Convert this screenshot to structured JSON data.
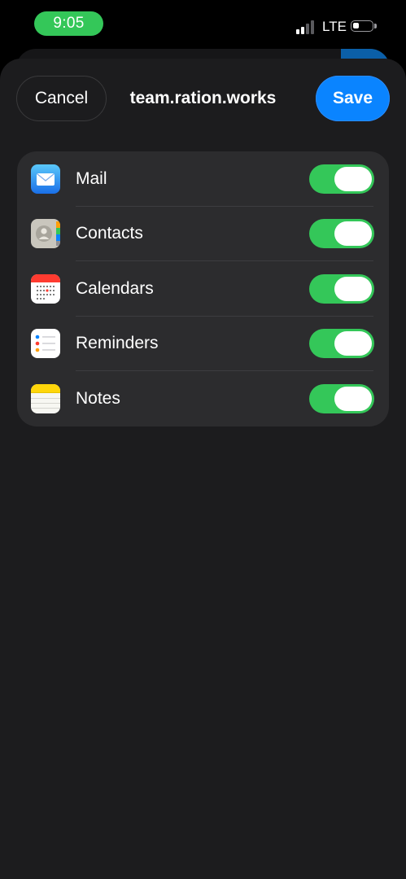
{
  "status_bar": {
    "time": "9:05",
    "network": "LTE",
    "signal_bars_filled": 2,
    "signal_bars_total": 4,
    "battery_level": 0.35
  },
  "colors": {
    "accent_blue": "#0a84ff",
    "toggle_on": "#34c759",
    "sheet_background": "#1c1c1e",
    "card_background": "#2c2c2e"
  },
  "header": {
    "cancel_label": "Cancel",
    "title": "team.ration.works",
    "save_label": "Save"
  },
  "services": [
    {
      "label": "Mail",
      "icon": "mail-icon",
      "enabled": true
    },
    {
      "label": "Contacts",
      "icon": "contacts-icon",
      "enabled": true
    },
    {
      "label": "Calendars",
      "icon": "calendar-icon",
      "enabled": true
    },
    {
      "label": "Reminders",
      "icon": "reminders-icon",
      "enabled": true
    },
    {
      "label": "Notes",
      "icon": "notes-icon",
      "enabled": true
    }
  ]
}
